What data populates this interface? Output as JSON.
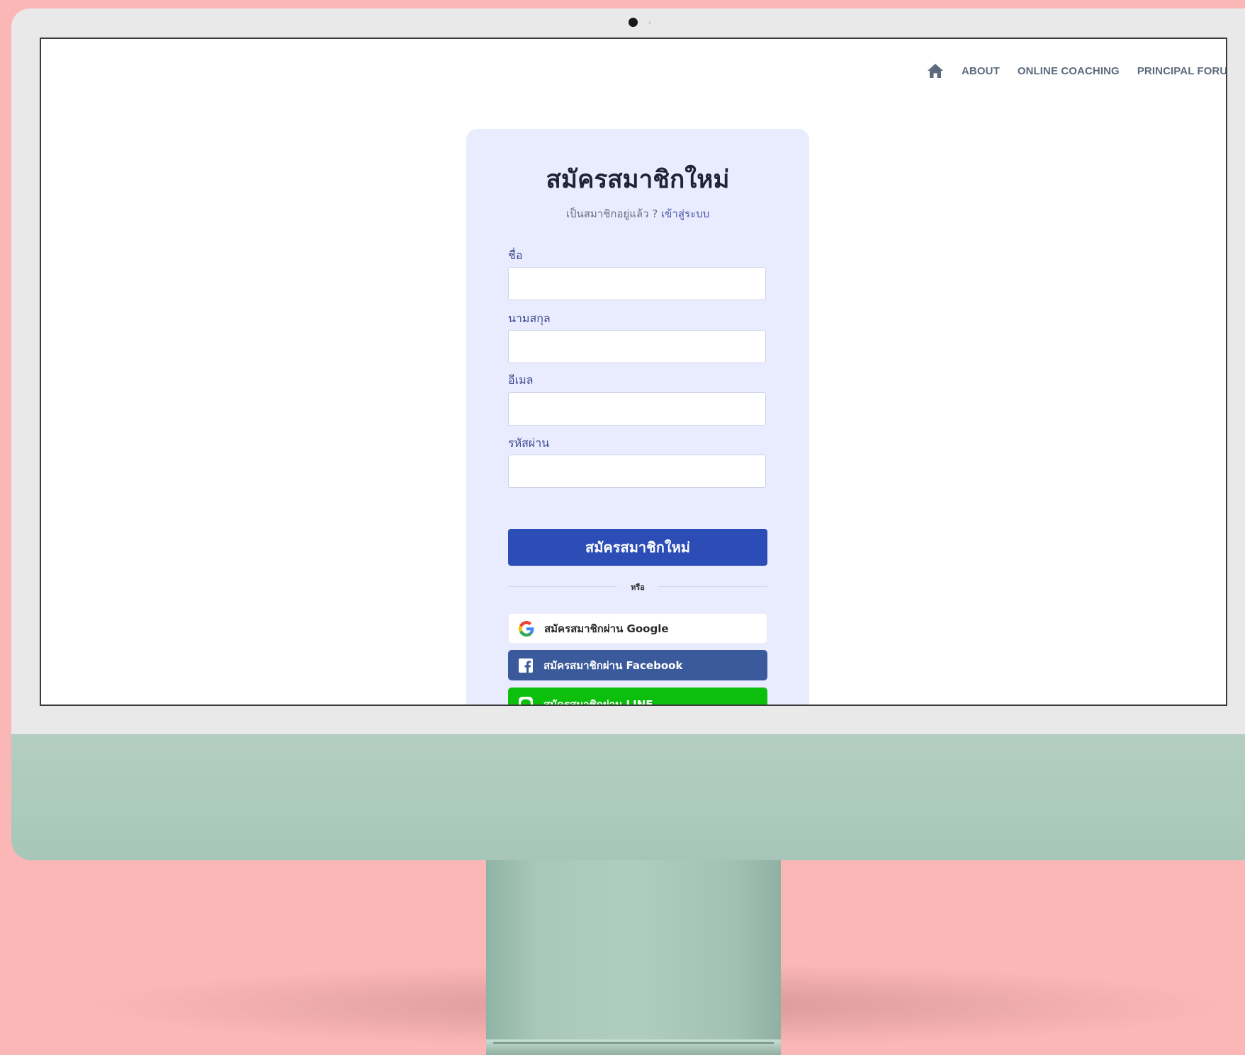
{
  "nav": {
    "items": [
      {
        "label": "ABOUT"
      },
      {
        "label": "ONLINE COACHING"
      },
      {
        "label": "PRINCIPAL FORU"
      }
    ]
  },
  "signup": {
    "title": "สมัครสมาชิกใหม่",
    "subtitle_prefix": "เป็นสมาชิกอยู่แล้ว ? ",
    "login_link": "เข้าสู่ระบบ",
    "fields": [
      {
        "label": "ชื่อ",
        "value": ""
      },
      {
        "label": "นามสกุล",
        "value": ""
      },
      {
        "label": "อีเมล",
        "value": ""
      },
      {
        "label": "รหัสผ่าน",
        "value": ""
      }
    ],
    "submit_label": "สมัครสมาชิกใหม่",
    "divider_text": "หรือ",
    "social": {
      "google": "สมัครสมาชิกผ่าน Google",
      "facebook": "สมัครสมาชิกผ่าน Facebook",
      "line": "สมัครสมาชิกผ่าน LINE"
    }
  },
  "colors": {
    "page_background": "#fbb7b6",
    "card_background": "#e9ebff",
    "primary_button": "#2b4db5",
    "facebook": "#3b5a9c",
    "line": "#0cbf0c",
    "monitor_chin": "#b3cdc2"
  },
  "icons": {
    "home": "home-icon",
    "google": "google-g-icon",
    "facebook": "facebook-icon",
    "line": "line-icon"
  }
}
